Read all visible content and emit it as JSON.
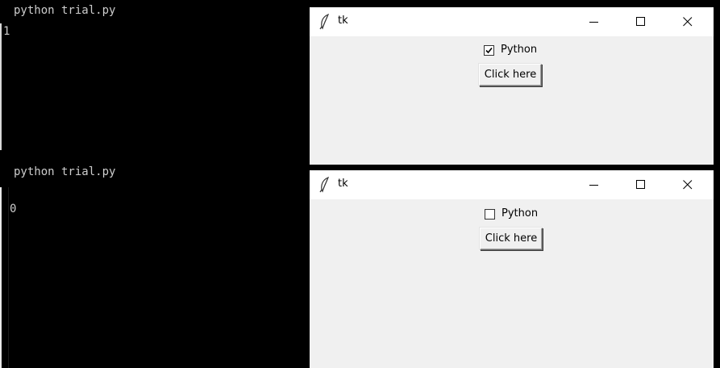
{
  "top": {
    "terminal": {
      "command": "python trial.py",
      "output": "1"
    },
    "window": {
      "title": "tk",
      "checkbox": {
        "label": "Python",
        "checked": true
      },
      "button_label": "Click here"
    }
  },
  "bottom": {
    "terminal": {
      "command": "python trial.py",
      "output": "0"
    },
    "window": {
      "title": "tk",
      "checkbox": {
        "label": "Python",
        "checked": false
      },
      "button_label": "Click here"
    }
  },
  "icons": [
    "tk-feather-icon",
    "minimize-icon",
    "maximize-icon",
    "close-icon",
    "checkmark-icon"
  ]
}
